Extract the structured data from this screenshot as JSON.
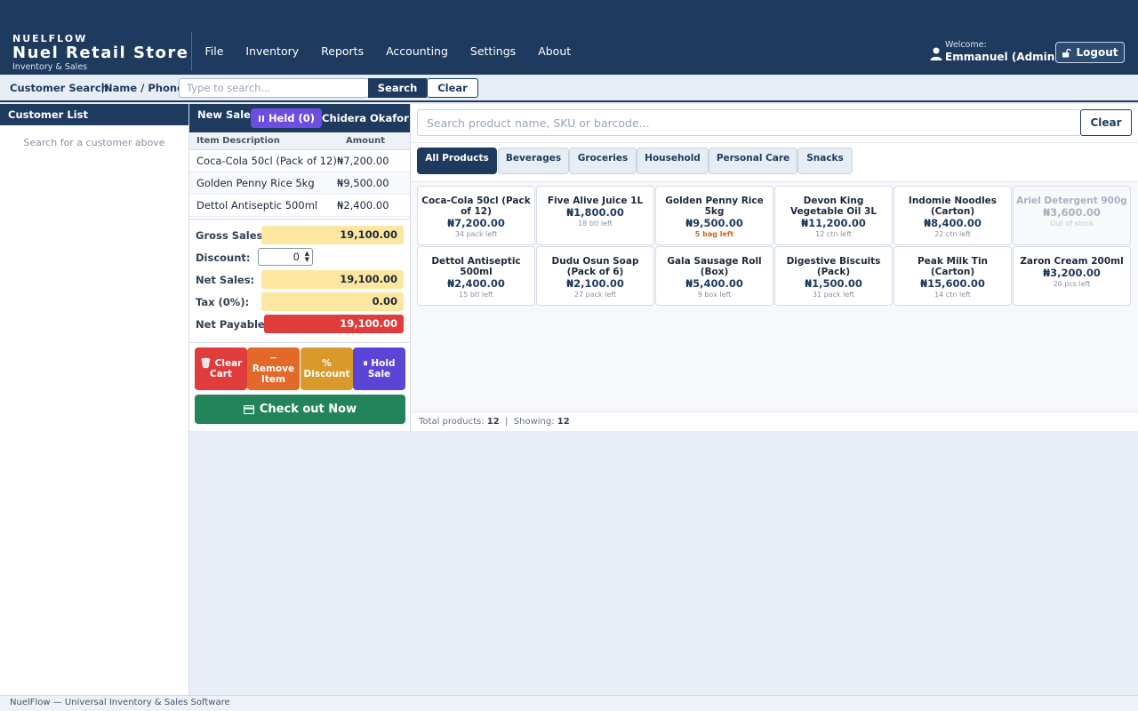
{
  "header": {
    "brand_small": "NUELFLOW",
    "brand_name": "Nuel Retail Store",
    "brand_tagline": "Inventory & Sales",
    "menu": [
      "File",
      "Inventory",
      "Reports",
      "Accounting",
      "Settings",
      "About"
    ],
    "welcome_label": "Welcome:",
    "user_name": "Emmanuel (Admin)",
    "logout_label": "Logout"
  },
  "customer_search": {
    "label": "Customer Search",
    "label2": "Name / Phone",
    "placeholder": "Type to search...",
    "search_label": "Search",
    "clear_label": "Clear"
  },
  "customer_list": {
    "title": "Customer List",
    "hint": "Search for a customer above"
  },
  "sale": {
    "new_sale_label": "New Sale",
    "held_label": "Held (0)",
    "customer_name": "Chidera Okafor",
    "col_item": "Item Description",
    "col_amount": "Amount",
    "items": [
      {
        "desc": "Coca-Cola 50cl (Pack of 12)",
        "amount": "₦7,200.00"
      },
      {
        "desc": "Golden Penny Rice 5kg",
        "amount": "₦9,500.00"
      },
      {
        "desc": "Dettol Antiseptic 500ml",
        "amount": "₦2,400.00"
      }
    ],
    "gross_label": "Gross Sales:",
    "gross_value": "19,100.00",
    "discount_label": "Discount:",
    "discount_value": "0",
    "net_label": "Net Sales:",
    "net_value": "19,100.00",
    "tax_label": "Tax (0%):",
    "tax_value": "0.00",
    "payable_label": "Net Payable:",
    "payable_value": "19,100.00",
    "actions": [
      {
        "line1": "Clear",
        "line2": "Cart",
        "icon": "trash-icon",
        "color": "#e03c3c"
      },
      {
        "line1": "Remove",
        "line2": "Item",
        "icon": "minus-icon",
        "color": "#e2692a"
      },
      {
        "line1": "Discount",
        "line2": "",
        "icon": "percent-icon",
        "color": "#d99a2b"
      },
      {
        "line1": "Hold",
        "line2": "Sale",
        "icon": "pause-icon",
        "color": "#5b45d6"
      }
    ],
    "checkout_label": "Check out Now"
  },
  "products": {
    "search_placeholder": "Search product name, SKU or barcode...",
    "clear_label": "Clear",
    "tabs": [
      "All Products",
      "Beverages",
      "Groceries",
      "Household",
      "Personal Care",
      "Snacks"
    ],
    "active_tab": "All Products",
    "items": [
      {
        "name1": "Coca-Cola 50cl (Pack",
        "name2": "of 12)",
        "price": "₦7,200.00",
        "stock": "34 pack left",
        "status": "ok"
      },
      {
        "name1": "Five Alive Juice 1L",
        "name2": "",
        "price": "₦1,800.00",
        "stock": "18 btl left",
        "status": "ok"
      },
      {
        "name1": "Golden Penny Rice",
        "name2": "5kg",
        "price": "₦9,500.00",
        "stock": "5 bag left",
        "status": "low"
      },
      {
        "name1": "Devon King",
        "name2": "Vegetable Oil 3L",
        "price": "₦11,200.00",
        "stock": "12 ctn left",
        "status": "ok"
      },
      {
        "name1": "Indomie Noodles",
        "name2": "(Carton)",
        "price": "₦8,400.00",
        "stock": "22 ctn left",
        "status": "ok"
      },
      {
        "name1": "Ariel Detergent 900g",
        "name2": "",
        "price": "₦3,600.00",
        "stock": "Out of stock",
        "status": "out"
      },
      {
        "name1": "Dettol Antiseptic",
        "name2": "500ml",
        "price": "₦2,400.00",
        "stock": "15 btl left",
        "status": "ok"
      },
      {
        "name1": "Dudu Osun Soap",
        "name2": "(Pack of 6)",
        "price": "₦2,100.00",
        "stock": "27 pack left",
        "status": "ok"
      },
      {
        "name1": "Gala Sausage Roll",
        "name2": "(Box)",
        "price": "₦5,400.00",
        "stock": "9 box left",
        "status": "ok"
      },
      {
        "name1": "Digestive Biscuits",
        "name2": "(Pack)",
        "price": "₦1,500.00",
        "stock": "31 pack left",
        "status": "ok"
      },
      {
        "name1": "Peak Milk Tin",
        "name2": "(Carton)",
        "price": "₦15,600.00",
        "stock": "14 ctn left",
        "status": "ok"
      },
      {
        "name1": "Zaron Cream 200ml",
        "name2": "",
        "price": "₦3,200.00",
        "stock": "20 pcs left",
        "status": "ok"
      }
    ],
    "total_label": "Total products:",
    "total_value": "12",
    "showing_label": "Showing:",
    "showing_value": "12"
  },
  "footer": {
    "text": "NuelFlow — Universal Inventory & Sales Software"
  },
  "colors": {
    "primary": "#1e3a5f",
    "checkout": "#23845b",
    "payable": "#e03c3c",
    "total_highlight": "#fde7a0",
    "held": "#6d4ee0"
  }
}
